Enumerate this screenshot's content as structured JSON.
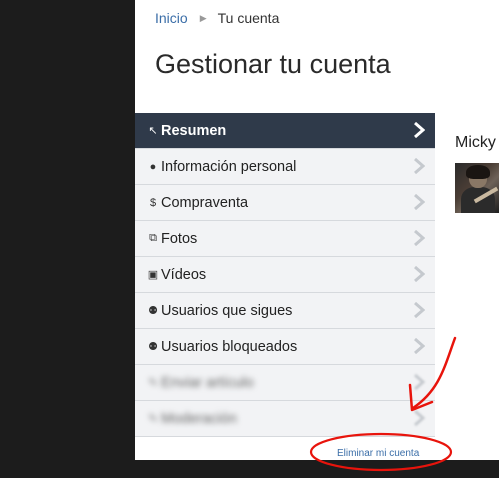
{
  "breadcrumb": {
    "home": "Inicio",
    "current": "Tu cuenta"
  },
  "page_title": "Gestionar tu cuenta",
  "menu": {
    "items": [
      {
        "label": "Resumen",
        "icon": "↖",
        "icon_name": "arrow-up-left-icon",
        "active": true
      },
      {
        "label": "Información personal",
        "icon": "●",
        "icon_name": "person-icon"
      },
      {
        "label": "Compraventa",
        "icon": "$",
        "icon_name": "dollar-icon"
      },
      {
        "label": "Fotos",
        "icon": "⧉",
        "icon_name": "photos-icon"
      },
      {
        "label": "Vídeos",
        "icon": "▣",
        "icon_name": "video-icon"
      },
      {
        "label": "Usuarios que sigues",
        "icon": "⚉",
        "icon_name": "users-icon"
      },
      {
        "label": "Usuarios bloqueados",
        "icon": "⚉",
        "icon_name": "blocked-users-icon"
      },
      {
        "label": "Enviar artículo",
        "icon": "✎",
        "icon_name": "send-icon",
        "blurred": true
      },
      {
        "label": "Moderación",
        "icon": "✎",
        "icon_name": "moderation-icon",
        "blurred": true
      }
    ]
  },
  "delete_account": "Eliminar mi cuenta",
  "profile": {
    "name": "Micky"
  },
  "colors": {
    "active_bg": "#2f3a4a",
    "link": "#3b6ea8",
    "annotation": "#e8140c"
  }
}
